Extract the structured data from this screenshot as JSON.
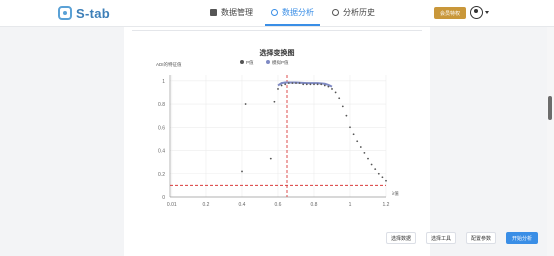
{
  "app": {
    "logo_text": "S-tab"
  },
  "nav": [
    {
      "label": "数据管理",
      "icon": "database-icon"
    },
    {
      "label": "数据分析",
      "icon": "chart-icon",
      "active": true
    },
    {
      "label": "分析历史",
      "icon": "history-icon"
    }
  ],
  "header": {
    "cta_label": "会员特权"
  },
  "colors": {
    "accent": "#3a8ee6",
    "cta": "#c9973a",
    "series_points": "#555555",
    "series_fit": "#7f8ac4",
    "threshold": "#d93c3c"
  },
  "chart_data": {
    "type": "scatter",
    "title": "选择变换图",
    "ylabel": "ADI的特征值",
    "xlabel": "λ值",
    "xlim": [
      0,
      1.2
    ],
    "ylim": [
      0,
      1.05
    ],
    "xticks": [
      "0.01",
      "0.2",
      "0.4",
      "0.6",
      "0.8",
      "1",
      "1.2"
    ],
    "yticks": [
      "0",
      "0.2",
      "0.4",
      "0.6",
      "0.8",
      "1"
    ],
    "legend_position": "top",
    "series": [
      {
        "name": "P值",
        "type": "scatter",
        "points": [
          [
            0.4,
            0.22
          ],
          [
            0.42,
            0.8
          ],
          [
            0.56,
            0.33
          ],
          [
            0.58,
            0.82
          ],
          [
            0.6,
            0.93
          ],
          [
            0.62,
            0.96
          ],
          [
            0.64,
            0.97
          ],
          [
            0.66,
            0.98
          ],
          [
            0.68,
            0.98
          ],
          [
            0.7,
            0.98
          ],
          [
            0.72,
            0.98
          ],
          [
            0.74,
            0.97
          ],
          [
            0.76,
            0.97
          ],
          [
            0.78,
            0.97
          ],
          [
            0.8,
            0.97
          ],
          [
            0.82,
            0.97
          ],
          [
            0.84,
            0.97
          ],
          [
            0.86,
            0.96
          ],
          [
            0.88,
            0.95
          ],
          [
            0.9,
            0.93
          ],
          [
            0.92,
            0.9
          ],
          [
            0.94,
            0.85
          ],
          [
            0.96,
            0.78
          ],
          [
            0.98,
            0.7
          ],
          [
            1.0,
            0.6
          ],
          [
            1.02,
            0.54
          ],
          [
            1.04,
            0.48
          ],
          [
            1.06,
            0.43
          ],
          [
            1.08,
            0.38
          ],
          [
            1.1,
            0.33
          ],
          [
            1.12,
            0.28
          ],
          [
            1.14,
            0.24
          ],
          [
            1.16,
            0.2
          ],
          [
            1.18,
            0.17
          ],
          [
            1.2,
            0.14
          ]
        ]
      },
      {
        "name": "模拟P值",
        "type": "line",
        "points": [
          [
            0.6,
            0.96
          ],
          [
            0.62,
            0.98
          ],
          [
            0.64,
            0.985
          ],
          [
            0.66,
            0.985
          ],
          [
            0.7,
            0.985
          ],
          [
            0.76,
            0.98
          ],
          [
            0.82,
            0.98
          ],
          [
            0.86,
            0.975
          ],
          [
            0.88,
            0.965
          ],
          [
            0.9,
            0.95
          ]
        ]
      }
    ],
    "threshold_y": 0.1,
    "optimal_x": 0.65
  },
  "actions": [
    {
      "label": "选择数据",
      "primary": false
    },
    {
      "label": "选择工具",
      "primary": false
    },
    {
      "label": "配置参数",
      "primary": false
    },
    {
      "label": "开始分析",
      "primary": true
    }
  ]
}
